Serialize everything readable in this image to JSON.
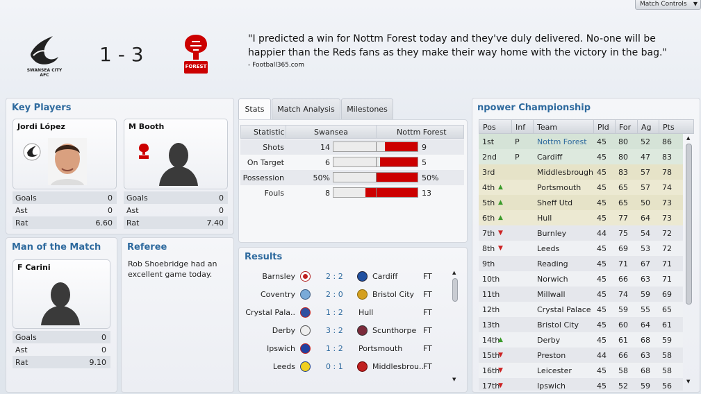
{
  "match_controls": "Match Controls",
  "score": "1 - 3",
  "home_logo_text": "SWANSEA CITY AFC",
  "away_logo_text": "FOREST",
  "quote": "\"I predicted a win for Nottm Forest today and they've duly delivered. No-one will be happier than the Reds fans as they make their way home with the victory in the bag.\"",
  "quote_source": "- Football365.com",
  "key_players": {
    "title": "Key Players",
    "players": [
      {
        "name": "Jordi López",
        "stats": [
          {
            "k": "Goals",
            "v": "0"
          },
          {
            "k": "Ast",
            "v": "0"
          },
          {
            "k": "Rat",
            "v": "6.60"
          }
        ]
      },
      {
        "name": "M Booth",
        "stats": [
          {
            "k": "Goals",
            "v": "0"
          },
          {
            "k": "Ast",
            "v": "0"
          },
          {
            "k": "Rat",
            "v": "7.40"
          }
        ]
      }
    ]
  },
  "motm": {
    "title": "Man of the Match",
    "name": "F Carini",
    "stats": [
      {
        "k": "Goals",
        "v": "0"
      },
      {
        "k": "Ast",
        "v": "0"
      },
      {
        "k": "Rat",
        "v": "9.10"
      }
    ]
  },
  "referee": {
    "title": "Referee",
    "text": "Rob Shoebridge had an excellent game today."
  },
  "tabs": [
    "Stats",
    "Match Analysis",
    "Milestones"
  ],
  "stats": {
    "headers": [
      "Statistic",
      "Swansea",
      "Nottm Forest"
    ],
    "rows": [
      {
        "label": "Shots",
        "home": "14",
        "away": "9",
        "away_share": 0.39
      },
      {
        "label": "On Target",
        "home": "6",
        "away": "5",
        "away_share": 0.45
      },
      {
        "label": "Possession",
        "home": "50%",
        "away": "50%",
        "away_share": 0.5
      },
      {
        "label": "Fouls",
        "home": "8",
        "away": "13",
        "away_share": 0.62
      }
    ]
  },
  "results": {
    "title": "Results",
    "rows": [
      {
        "home": "Barnsley",
        "score": "2 : 2",
        "away": "Cardiff",
        "status": "FT"
      },
      {
        "home": "Coventry",
        "score": "2 : 0",
        "away": "Bristol City",
        "status": "FT"
      },
      {
        "home": "Crystal Pala..",
        "score": "1 : 2",
        "away": "Hull",
        "status": "FT"
      },
      {
        "home": "Derby",
        "score": "3 : 2",
        "away": "Scunthorpe",
        "status": "FT"
      },
      {
        "home": "Ipswich",
        "score": "1 : 2",
        "away": "Portsmouth",
        "status": "FT"
      },
      {
        "home": "Leeds",
        "score": "0 : 1",
        "away": "Middlesbrou..",
        "status": "FT"
      }
    ]
  },
  "league": {
    "title": "npower Championship",
    "headers": [
      "Pos",
      "Inf",
      "Team",
      "Pld",
      "For",
      "Ag",
      "Pts"
    ],
    "rows": [
      {
        "pos": "1st",
        "inf": "P",
        "team": "Nottm Forest",
        "pld": "45",
        "for": "80",
        "ag": "52",
        "pts": "86",
        "move": "",
        "hl": "green"
      },
      {
        "pos": "2nd",
        "inf": "P",
        "team": "Cardiff",
        "pld": "45",
        "for": "80",
        "ag": "47",
        "pts": "83",
        "move": "",
        "hl": "green"
      },
      {
        "pos": "3rd",
        "inf": "",
        "team": "Middlesbrough",
        "pld": "45",
        "for": "83",
        "ag": "57",
        "pts": "78",
        "move": "",
        "hl": "yellow"
      },
      {
        "pos": "4th",
        "inf": "",
        "team": "Portsmouth",
        "pld": "45",
        "for": "65",
        "ag": "57",
        "pts": "74",
        "move": "up",
        "hl": "yellow"
      },
      {
        "pos": "5th",
        "inf": "",
        "team": "Sheff Utd",
        "pld": "45",
        "for": "65",
        "ag": "50",
        "pts": "73",
        "move": "up",
        "hl": "yellow"
      },
      {
        "pos": "6th",
        "inf": "",
        "team": "Hull",
        "pld": "45",
        "for": "77",
        "ag": "64",
        "pts": "73",
        "move": "up",
        "hl": "yellow"
      },
      {
        "pos": "7th",
        "inf": "",
        "team": "Burnley",
        "pld": "44",
        "for": "75",
        "ag": "54",
        "pts": "72",
        "move": "down",
        "hl": ""
      },
      {
        "pos": "8th",
        "inf": "",
        "team": "Leeds",
        "pld": "45",
        "for": "69",
        "ag": "53",
        "pts": "72",
        "move": "down",
        "hl": ""
      },
      {
        "pos": "9th",
        "inf": "",
        "team": "Reading",
        "pld": "45",
        "for": "71",
        "ag": "67",
        "pts": "71",
        "move": "",
        "hl": ""
      },
      {
        "pos": "10th",
        "inf": "",
        "team": "Norwich",
        "pld": "45",
        "for": "66",
        "ag": "63",
        "pts": "71",
        "move": "",
        "hl": ""
      },
      {
        "pos": "11th",
        "inf": "",
        "team": "Millwall",
        "pld": "45",
        "for": "74",
        "ag": "59",
        "pts": "69",
        "move": "",
        "hl": ""
      },
      {
        "pos": "12th",
        "inf": "",
        "team": "Crystal Palace",
        "pld": "45",
        "for": "59",
        "ag": "55",
        "pts": "65",
        "move": "",
        "hl": ""
      },
      {
        "pos": "13th",
        "inf": "",
        "team": "Bristol City",
        "pld": "45",
        "for": "60",
        "ag": "64",
        "pts": "61",
        "move": "",
        "hl": ""
      },
      {
        "pos": "14th",
        "inf": "",
        "team": "Derby",
        "pld": "45",
        "for": "61",
        "ag": "68",
        "pts": "59",
        "move": "up",
        "hl": ""
      },
      {
        "pos": "15th",
        "inf": "",
        "team": "Preston",
        "pld": "44",
        "for": "66",
        "ag": "63",
        "pts": "58",
        "move": "down",
        "hl": ""
      },
      {
        "pos": "16th",
        "inf": "",
        "team": "Leicester",
        "pld": "45",
        "for": "58",
        "ag": "68",
        "pts": "58",
        "move": "down",
        "hl": ""
      },
      {
        "pos": "17th",
        "inf": "",
        "team": "Ipswich",
        "pld": "45",
        "for": "52",
        "ag": "59",
        "pts": "56",
        "move": "down",
        "hl": ""
      }
    ]
  },
  "colors": {
    "accent": "#2e6a9e",
    "forest_red": "#cc0000",
    "up": "#3a9b2a",
    "down": "#cc2222",
    "promo": "#d8e6d8",
    "playoff": "#e9e5c9"
  }
}
